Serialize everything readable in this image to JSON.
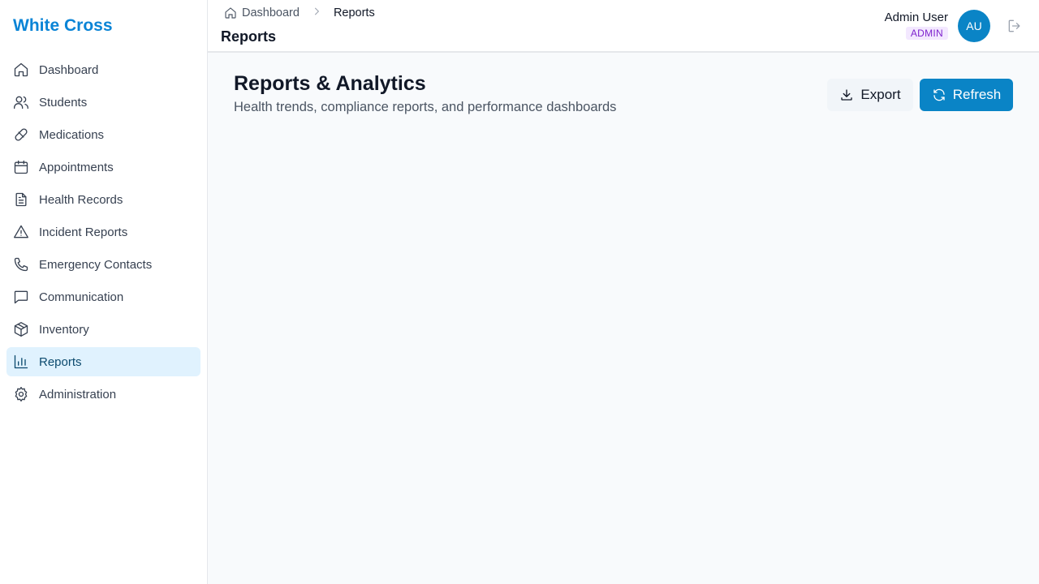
{
  "app": {
    "brand": "White Cross"
  },
  "sidebar": {
    "items": [
      {
        "label": "Dashboard",
        "icon": "home-icon",
        "active": false
      },
      {
        "label": "Students",
        "icon": "users-icon",
        "active": false
      },
      {
        "label": "Medications",
        "icon": "pill-icon",
        "active": false
      },
      {
        "label": "Appointments",
        "icon": "calendar-icon",
        "active": false
      },
      {
        "label": "Health Records",
        "icon": "file-text-icon",
        "active": false
      },
      {
        "label": "Incident Reports",
        "icon": "alert-triangle-icon",
        "active": false
      },
      {
        "label": "Emergency Contacts",
        "icon": "phone-icon",
        "active": false
      },
      {
        "label": "Communication",
        "icon": "message-square-icon",
        "active": false
      },
      {
        "label": "Inventory",
        "icon": "package-icon",
        "active": false
      },
      {
        "label": "Reports",
        "icon": "bar-chart-icon",
        "active": true
      },
      {
        "label": "Administration",
        "icon": "gear-icon",
        "active": false
      }
    ]
  },
  "header": {
    "breadcrumb": {
      "home_label": "Dashboard",
      "current": "Reports"
    },
    "title": "Reports",
    "user": {
      "name": "Admin User",
      "role": "ADMIN",
      "initials": "AU"
    }
  },
  "main": {
    "title": "Reports & Analytics",
    "subtitle": "Health trends, compliance reports, and performance dashboards",
    "export_label": "Export",
    "refresh_label": "Refresh"
  },
  "colors": {
    "brand": "#0a84d6",
    "accent": "#0a84c6",
    "active_bg": "#e0f2fe",
    "role_badge_bg": "#f3e8ff",
    "role_badge_text": "#7e22ce"
  }
}
